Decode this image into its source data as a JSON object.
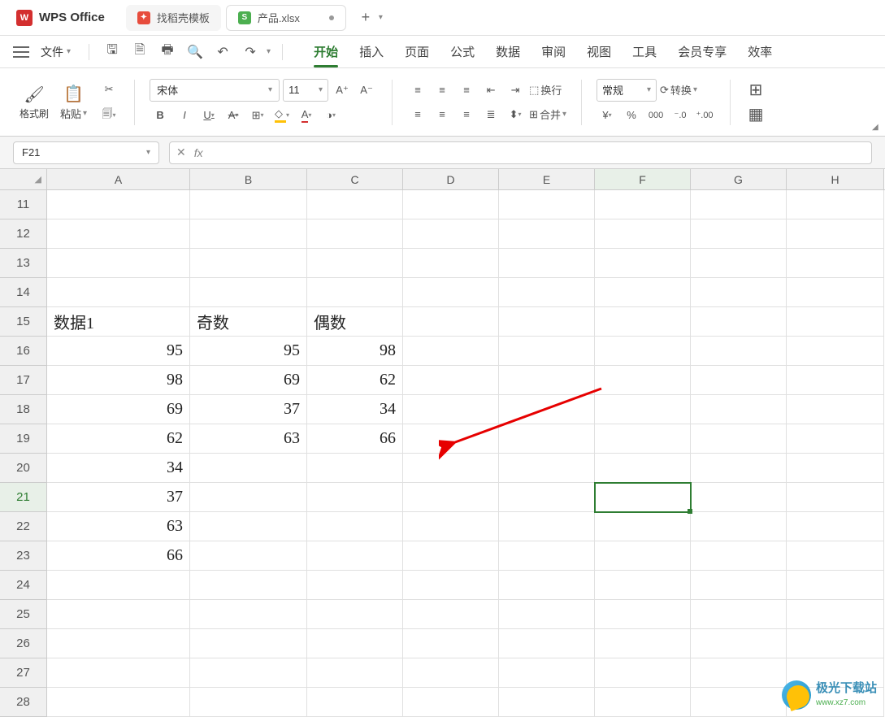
{
  "app": {
    "name": "WPS Office"
  },
  "tabs": {
    "template": "找稻壳模板",
    "active": "产品.xlsx",
    "new": "+"
  },
  "file_menu": "文件",
  "menu": {
    "items": [
      "开始",
      "插入",
      "页面",
      "公式",
      "数据",
      "审阅",
      "视图",
      "工具",
      "会员专享",
      "效率"
    ],
    "active": 0
  },
  "ribbon": {
    "format_painter": "格式刷",
    "paste": "粘贴",
    "font_name": "宋体",
    "font_size": "11",
    "wrap": "换行",
    "merge": "合并",
    "number_format": "常规",
    "convert": "转换",
    "currency": "¥",
    "percent": "%",
    "thousands": "000",
    "dec_inc": "⁺.0₀",
    "dec_dec": ".00"
  },
  "name_box": "F21",
  "columns": [
    "A",
    "B",
    "C",
    "D",
    "E",
    "F",
    "G",
    "H"
  ],
  "col_widths": [
    "cw-a",
    "cw-b",
    "cw-c",
    "cw-d",
    "cw-e",
    "cw-f",
    "cw-g",
    "cw-h"
  ],
  "row_start": 11,
  "row_end": 28,
  "selected_cell": {
    "row": 21,
    "col": "F"
  },
  "cells": {
    "15": {
      "A": "数据1",
      "B": "奇数",
      "C": "偶数"
    },
    "16": {
      "A": "95",
      "B": "95",
      "C": "98"
    },
    "17": {
      "A": "98",
      "B": "69",
      "C": "62"
    },
    "18": {
      "A": "69",
      "B": "37",
      "C": "34"
    },
    "19": {
      "A": "62",
      "B": "63",
      "C": "66"
    },
    "20": {
      "A": "34"
    },
    "21": {
      "A": "37"
    },
    "22": {
      "A": "63"
    },
    "23": {
      "A": "66"
    }
  },
  "watermark": {
    "name": "极光下载站",
    "url": "www.xz7.com"
  }
}
